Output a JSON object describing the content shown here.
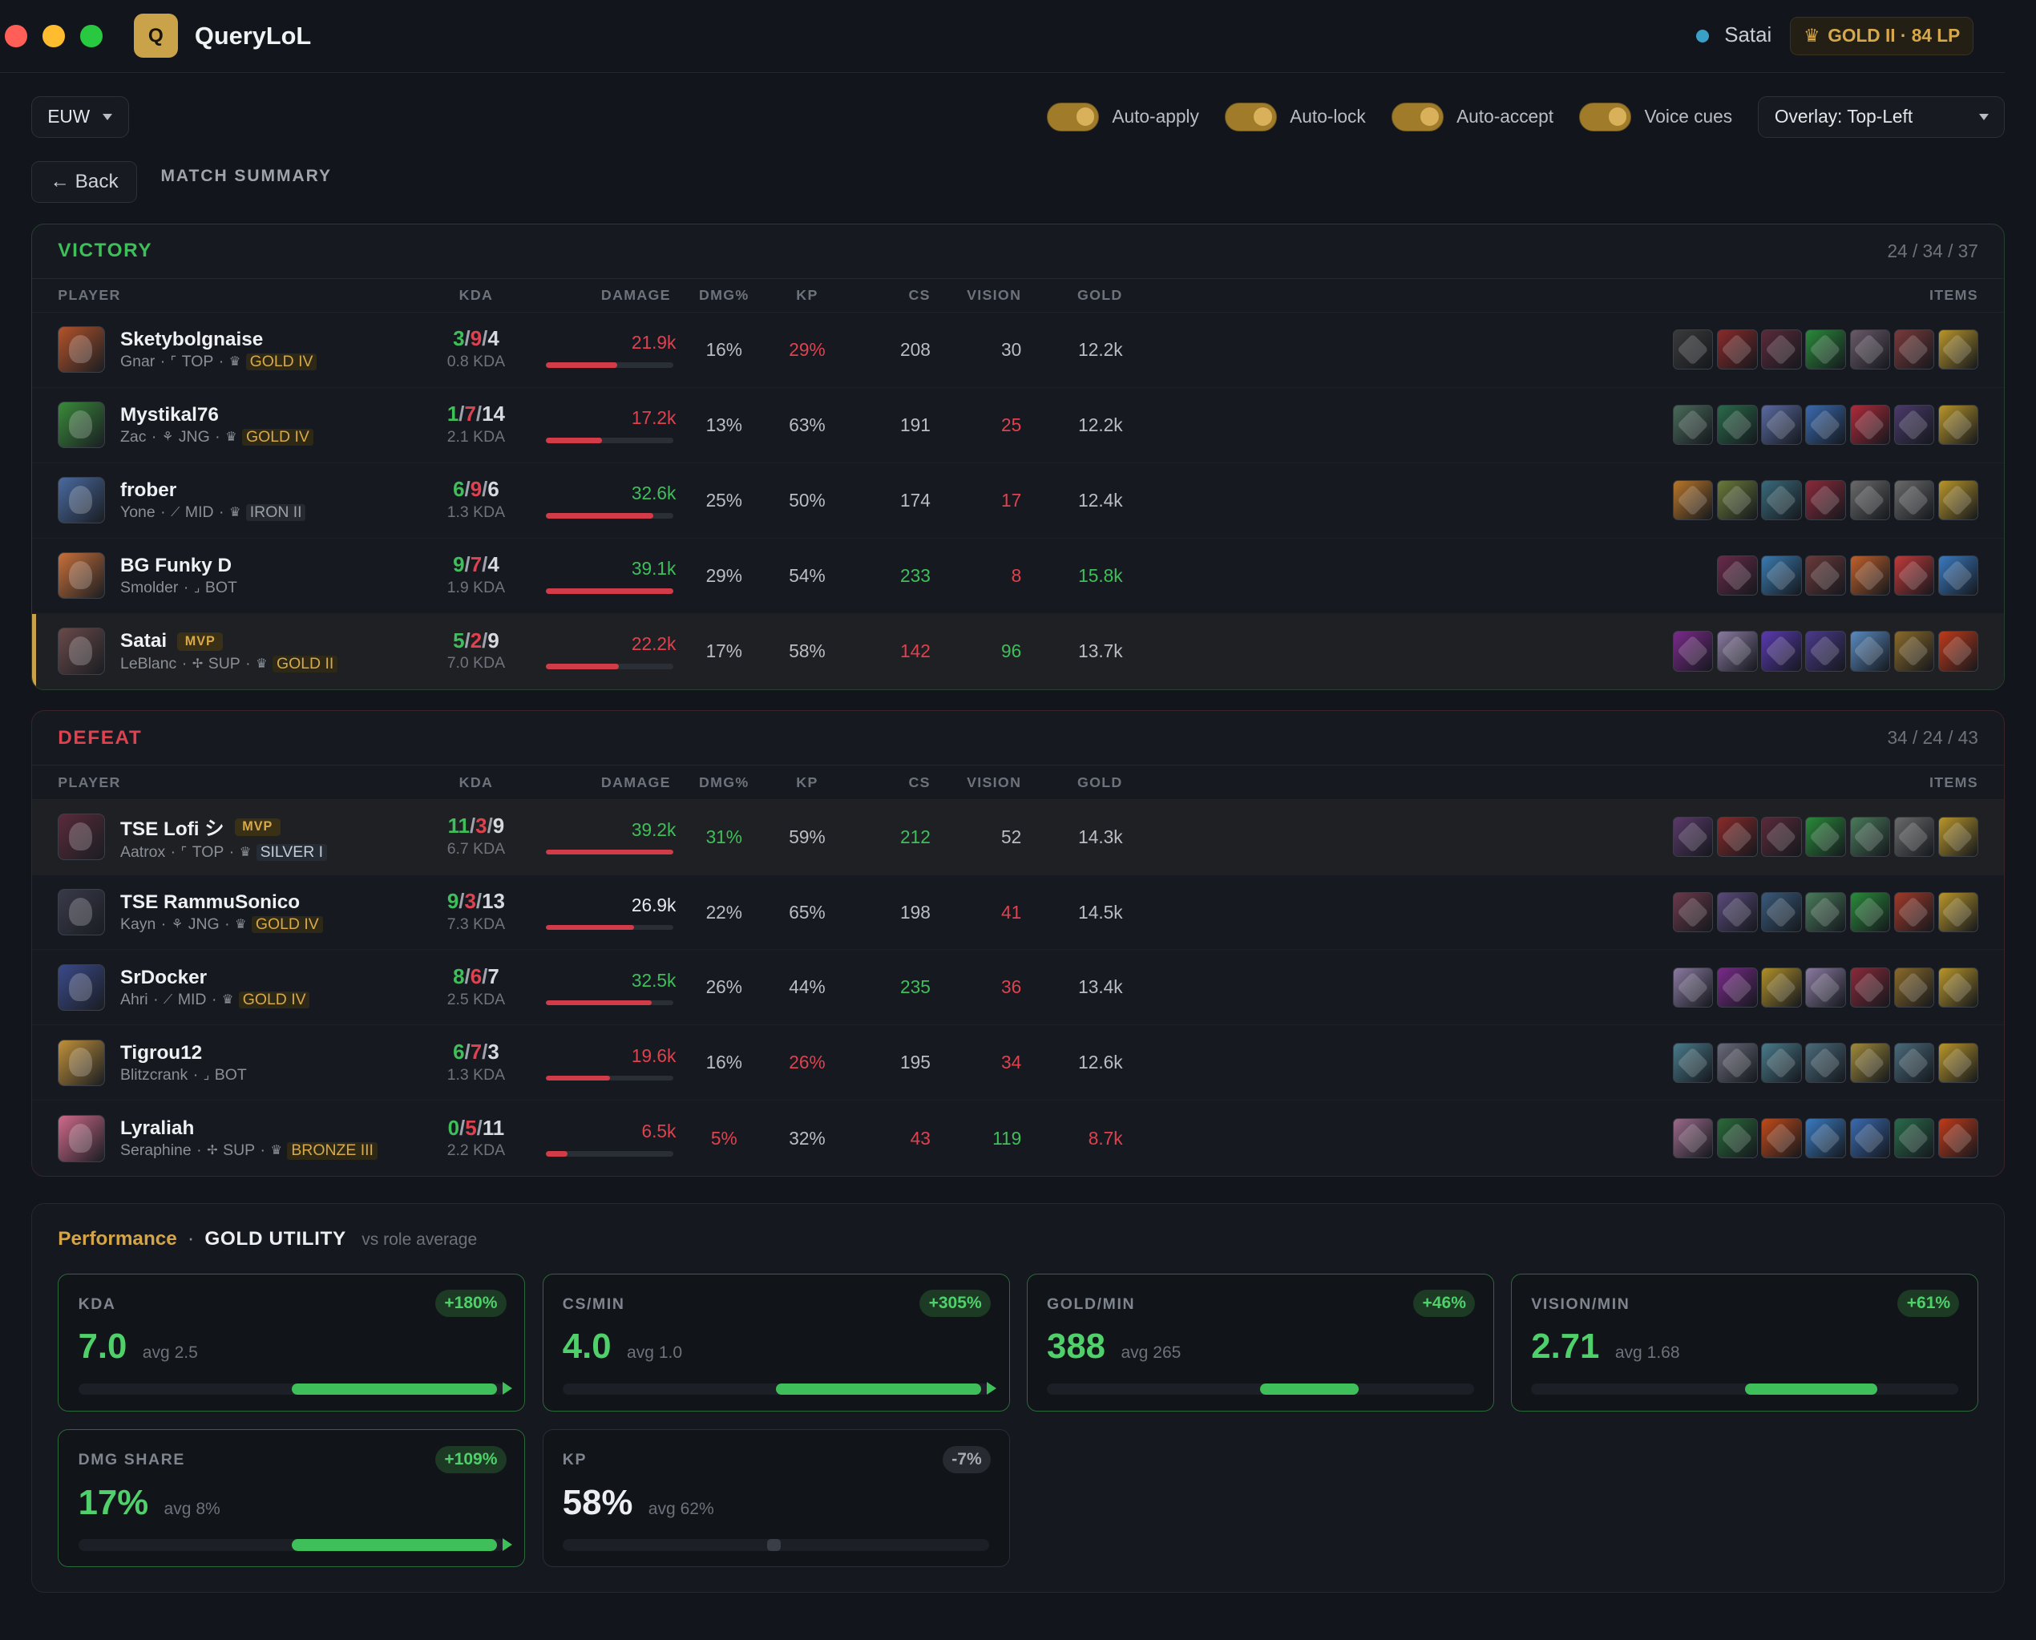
{
  "app": {
    "title": "QueryLoL",
    "logo_letter": "Q",
    "summoner": "Satai",
    "rank_badge": "GOLD II · 84 LP",
    "accent": "#c9a24a"
  },
  "toolbar": {
    "region": "EUW",
    "toggles": [
      {
        "label": "Auto-apply",
        "on": true
      },
      {
        "label": "Auto-lock",
        "on": true
      },
      {
        "label": "Auto-accept",
        "on": true
      },
      {
        "label": "Voice cues",
        "on": true
      }
    ],
    "overlay": "Overlay: Top-Left",
    "back_label": "← Back",
    "page_title": "MATCH SUMMARY"
  },
  "columns": {
    "player": "PLAYER",
    "kda": "KDA",
    "damage": "DAMAGE",
    "dmg_pct": "DMG%",
    "kp": "KP",
    "cs": "CS",
    "vision": "VISION",
    "gold": "GOLD",
    "items": "ITEMS"
  },
  "teams": [
    {
      "key": "victory",
      "label": "VICTORY",
      "score": "24 / 34 / 37",
      "players": [
        {
          "name": "Sketybolgnaise",
          "mvp": false,
          "self": false,
          "highlight": false,
          "champion": "Gnar",
          "role": "TOP",
          "rank": "GOLD IV",
          "rank_type": "gold",
          "k": "3",
          "d": "9",
          "a": "4",
          "kda_ratio": "0.8 KDA",
          "damage": "21.9k",
          "damage_frac": 0.56,
          "damage_class": "bad",
          "dmg_pct": "16%",
          "dmg_pct_class": "",
          "kp": "29%",
          "kp_class": "bad",
          "cs": "208",
          "cs_class": "",
          "vision": "30",
          "vision_class": "",
          "gold": "12.2k",
          "gold_class": "",
          "champ_color": "#b4532a",
          "items": [
            "#3a3a3a",
            "#8a2a2a",
            "#5a2a3a",
            "#2a8a3a",
            "#6a5a6a",
            "#7a3a3a",
            "#b8962a"
          ]
        },
        {
          "name": "Mystikal76",
          "mvp": false,
          "self": false,
          "highlight": false,
          "champion": "Zac",
          "role": "JNG",
          "rank": "GOLD IV",
          "rank_type": "gold",
          "k": "1",
          "d": "7",
          "a": "14",
          "kda_ratio": "2.1 KDA",
          "damage": "17.2k",
          "damage_frac": 0.44,
          "damage_class": "bad",
          "dmg_pct": "13%",
          "dmg_pct_class": "",
          "kp": "63%",
          "kp_class": "",
          "cs": "191",
          "cs_class": "",
          "vision": "25",
          "vision_class": "bad",
          "gold": "12.2k",
          "gold_class": "",
          "champ_color": "#3a8a3a",
          "items": [
            "#4a6a5a",
            "#2a6a4a",
            "#5a6aa0",
            "#3a6ab0",
            "#b02a3a",
            "#4a3a6a",
            "#b8962a"
          ]
        },
        {
          "name": "frober",
          "mvp": false,
          "self": false,
          "highlight": false,
          "champion": "Yone",
          "role": "MID",
          "rank": "IRON II",
          "rank_type": "iron",
          "k": "6",
          "d": "9",
          "a": "6",
          "kda_ratio": "1.3 KDA",
          "damage": "32.6k",
          "damage_frac": 0.84,
          "damage_class": "good",
          "dmg_pct": "25%",
          "dmg_pct_class": "",
          "kp": "50%",
          "kp_class": "",
          "cs": "174",
          "cs_class": "",
          "vision": "17",
          "vision_class": "bad",
          "gold": "12.4k",
          "gold_class": "",
          "champ_color": "#4a6aa0",
          "items": [
            "#b8762a",
            "#6a7a3a",
            "#3a6a7a",
            "#8a2a3a",
            "#6a6a6a",
            "#6a6a6a",
            "#b8962a"
          ]
        },
        {
          "name": "BG Funky D",
          "mvp": false,
          "self": false,
          "highlight": false,
          "champion": "Smolder",
          "role": "BOT",
          "rank": "",
          "rank_type": "",
          "k": "9",
          "d": "7",
          "a": "4",
          "kda_ratio": "1.9 KDA",
          "damage": "39.1k",
          "damage_frac": 1.0,
          "damage_class": "good",
          "dmg_pct": "29%",
          "dmg_pct_class": "",
          "kp": "54%",
          "kp_class": "",
          "cs": "233",
          "cs_class": "good",
          "vision": "8",
          "vision_class": "bad",
          "gold": "15.8k",
          "gold_class": "good",
          "champ_color": "#c8703a",
          "items": [
            "#6a2a4a",
            "#3a7ab0",
            "#6a3a3a",
            "#c0602a",
            "#c03a3a",
            "#3a7ac0"
          ]
        },
        {
          "name": "Satai",
          "mvp": true,
          "self": true,
          "highlight": true,
          "champion": "LeBlanc",
          "role": "SUP",
          "rank": "GOLD II",
          "rank_type": "gold",
          "k": "5",
          "d": "2",
          "a": "9",
          "kda_ratio": "7.0 KDA",
          "damage": "22.2k",
          "damage_frac": 0.57,
          "damage_class": "bad",
          "dmg_pct": "17%",
          "dmg_pct_class": "",
          "kp": "58%",
          "kp_class": "",
          "cs": "142",
          "cs_class": "bad",
          "vision": "96",
          "vision_class": "good",
          "gold": "13.7k",
          "gold_class": "",
          "champ_color": "#6a4a4a",
          "items": [
            "#7a2a8a",
            "#8a7aa0",
            "#5a3ab0",
            "#4a3a8a",
            "#5a8ac0",
            "#8a6a2a",
            "#c03a1a"
          ]
        }
      ]
    },
    {
      "key": "defeat",
      "label": "DEFEAT",
      "score": "34 / 24 / 43",
      "players": [
        {
          "name": "TSE Lofi シ",
          "mvp": true,
          "self": false,
          "highlight": true,
          "champion": "Aatrox",
          "role": "TOP",
          "rank": "SILVER I",
          "rank_type": "silver",
          "k": "11",
          "d": "3",
          "a": "9",
          "kda_ratio": "6.7 KDA",
          "damage": "39.2k",
          "damage_frac": 1.0,
          "damage_class": "good",
          "dmg_pct": "31%",
          "dmg_pct_class": "good",
          "kp": "59%",
          "kp_class": "",
          "cs": "212",
          "cs_class": "good",
          "vision": "52",
          "vision_class": "",
          "gold": "14.3k",
          "gold_class": "",
          "champ_color": "#5a2a3a",
          "items": [
            "#5a3a6a",
            "#8a2a2a",
            "#5a2a3a",
            "#2a8a3a",
            "#4a7a5a",
            "#6a6a6a",
            "#b8962a"
          ]
        },
        {
          "name": "TSE RammuSonico",
          "mvp": false,
          "self": false,
          "highlight": false,
          "champion": "Kayn",
          "role": "JNG",
          "rank": "GOLD IV",
          "rank_type": "gold",
          "k": "9",
          "d": "3",
          "a": "13",
          "kda_ratio": "7.3 KDA",
          "damage": "26.9k",
          "damage_frac": 0.69,
          "damage_class": "",
          "dmg_pct": "22%",
          "dmg_pct_class": "",
          "kp": "65%",
          "kp_class": "",
          "cs": "198",
          "cs_class": "",
          "vision": "41",
          "vision_class": "bad",
          "gold": "14.5k",
          "gold_class": "",
          "champ_color": "#3a3a4a",
          "items": [
            "#6a3a4a",
            "#5a4a7a",
            "#3a5a7a",
            "#4a7a5a",
            "#2a8a3a",
            "#a03a2a",
            "#b8962a"
          ]
        },
        {
          "name": "SrDocker",
          "mvp": false,
          "self": false,
          "highlight": false,
          "champion": "Ahri",
          "role": "MID",
          "rank": "GOLD IV",
          "rank_type": "gold",
          "k": "8",
          "d": "6",
          "a": "7",
          "kda_ratio": "2.5 KDA",
          "damage": "32.5k",
          "damage_frac": 0.83,
          "damage_class": "good",
          "dmg_pct": "26%",
          "dmg_pct_class": "",
          "kp": "44%",
          "kp_class": "",
          "cs": "235",
          "cs_class": "good",
          "vision": "36",
          "vision_class": "bad",
          "gold": "13.4k",
          "gold_class": "",
          "champ_color": "#3a4a8a",
          "items": [
            "#8a7aa0",
            "#7a2a8a",
            "#b0902a",
            "#8a7aa0",
            "#8a2a3a",
            "#8a6a2a",
            "#b8962a"
          ]
        },
        {
          "name": "Tigrou12",
          "mvp": false,
          "self": false,
          "highlight": false,
          "champion": "Blitzcrank",
          "role": "BOT",
          "rank": "",
          "rank_type": "",
          "k": "6",
          "d": "7",
          "a": "3",
          "kda_ratio": "1.3 KDA",
          "damage": "19.6k",
          "damage_frac": 0.5,
          "damage_class": "bad",
          "dmg_pct": "16%",
          "dmg_pct_class": "",
          "kp": "26%",
          "kp_class": "bad",
          "cs": "195",
          "cs_class": "",
          "vision": "34",
          "vision_class": "bad",
          "gold": "12.6k",
          "gold_class": "",
          "champ_color": "#c0903a",
          "items": [
            "#4a7a8a",
            "#6a6a7a",
            "#4a7a8a",
            "#4a6a7a",
            "#a08a3a",
            "#4a6a7a",
            "#b8962a"
          ]
        },
        {
          "name": "Lyraliah",
          "mvp": false,
          "self": false,
          "highlight": false,
          "champion": "Seraphine",
          "role": "SUP",
          "rank": "BRONZE III",
          "rank_type": "gold",
          "k": "0",
          "d": "5",
          "a": "11",
          "kda_ratio": "2.2 KDA",
          "damage": "6.5k",
          "damage_frac": 0.17,
          "damage_class": "bad",
          "dmg_pct": "5%",
          "dmg_pct_class": "bad",
          "kp": "32%",
          "kp_class": "",
          "cs": "43",
          "cs_class": "bad",
          "vision": "119",
          "vision_class": "good",
          "gold": "8.7k",
          "gold_class": "bad",
          "champ_color": "#d06a8a",
          "items": [
            "#9a6a8a",
            "#2a6a3a",
            "#c04a1a",
            "#3a7ac0",
            "#3a6ab0",
            "#2a6a4a",
            "#c03a1a"
          ]
        }
      ]
    }
  ],
  "performance": {
    "title": "Performance",
    "separator": "·",
    "role": "GOLD UTILITY",
    "vs": "vs role average",
    "cards": [
      {
        "label": "KDA",
        "delta": "+180%",
        "value": "7.0",
        "avg": "avg 2.5",
        "positive": true,
        "fill_start": 0.5,
        "fill_end": 1.0,
        "arrow": true
      },
      {
        "label": "CS/MIN",
        "delta": "+305%",
        "value": "4.0",
        "avg": "avg 1.0",
        "positive": true,
        "fill_start": 0.5,
        "fill_end": 1.0,
        "arrow": true
      },
      {
        "label": "GOLD/MIN",
        "delta": "+46%",
        "value": "388",
        "avg": "avg 265",
        "positive": true,
        "fill_start": 0.5,
        "fill_end": 0.73,
        "arrow": false
      },
      {
        "label": "VISION/MIN",
        "delta": "+61%",
        "value": "2.71",
        "avg": "avg 1.68",
        "positive": true,
        "fill_start": 0.5,
        "fill_end": 0.81,
        "arrow": false
      },
      {
        "label": "DMG SHARE",
        "delta": "+109%",
        "value": "17%",
        "avg": "avg 8%",
        "positive": true,
        "fill_start": 0.5,
        "fill_end": 1.0,
        "arrow": true
      },
      {
        "label": "KP",
        "delta": "-7%",
        "value": "58%",
        "avg": "avg 62%",
        "positive": false,
        "fill_start": 0.48,
        "fill_end": 0.5,
        "arrow": false
      }
    ]
  }
}
